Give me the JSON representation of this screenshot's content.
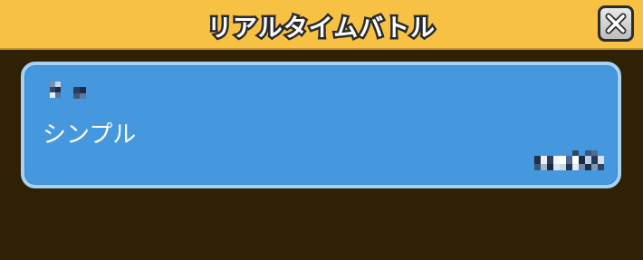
{
  "header": {
    "title": "リアルタイムバトル",
    "close_icon": "close-x-icon",
    "background_color": "#f7c243"
  },
  "mode_list": {
    "items": [
      {
        "name": "シンプル",
        "card_color": "#4698de",
        "border_color": "#a8d2f5"
      }
    ]
  },
  "background_color": "#2f2104"
}
